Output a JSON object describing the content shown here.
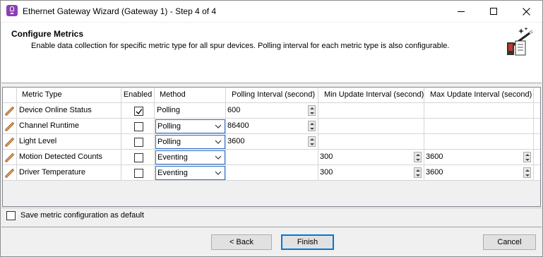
{
  "window": {
    "title": "Ethernet Gateway Wizard (Gateway 1) - Step 4 of 4",
    "controls": [
      "minimize-icon",
      "maximize-icon",
      "close-icon"
    ]
  },
  "header": {
    "title": "Configure Metrics",
    "description": "Enable data collection for specific metric type for all spur devices. Polling interval for each metric type is also configurable.",
    "icon": "wizard-wand-icon"
  },
  "grid": {
    "columns": [
      "Metric Type",
      "Enabled",
      "Method",
      "Polling Interval (second)",
      "Min Update Interval (second)",
      "Max Update Interval (second)"
    ],
    "rows": [
      {
        "metric": "Device Online Status",
        "enabled": true,
        "method": "Polling",
        "polling": "600",
        "min": "",
        "max": ""
      },
      {
        "metric": "Channel Runtime",
        "enabled": false,
        "method": "Polling",
        "polling": "86400",
        "min": "",
        "max": ""
      },
      {
        "metric": "Light Level",
        "enabled": false,
        "method": "Polling",
        "polling": "3600",
        "min": "",
        "max": ""
      },
      {
        "metric": "Motion Detected Counts",
        "enabled": false,
        "method": "Eventing",
        "polling": "",
        "min": "300",
        "max": "3600"
      },
      {
        "metric": "Driver Temperature",
        "enabled": false,
        "method": "Eventing",
        "polling": "",
        "min": "300",
        "max": "3600"
      }
    ]
  },
  "options": {
    "save_default_label": "Save metric configuration as default",
    "save_default_checked": false
  },
  "buttons": {
    "back": "< Back",
    "finish": "Finish",
    "cancel": "Cancel"
  },
  "colors": {
    "accent": "#0078d7",
    "app_icon": "#8e3fb5"
  }
}
